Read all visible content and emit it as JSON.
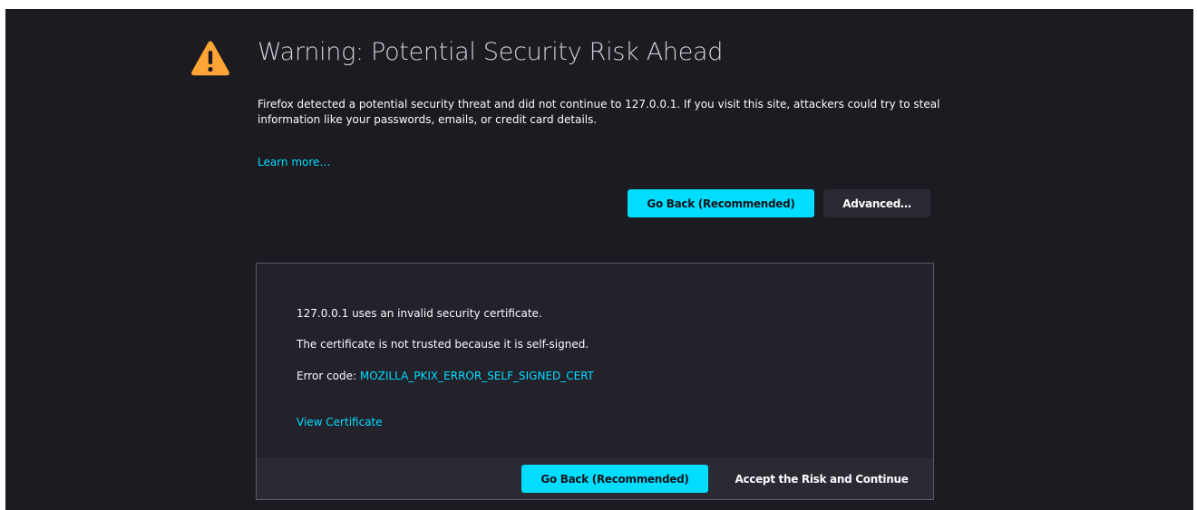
{
  "header": {
    "title": "Warning: Potential Security Risk Ahead",
    "icon": "warning-triangle-icon"
  },
  "description": "Firefox detected a potential security threat and did not continue to 127.0.0.1. If you visit this site, attackers could try to steal information like your passwords, emails, or credit card details.",
  "learn_more": "Learn more…",
  "buttons": {
    "go_back": "Go Back (Recommended)",
    "advanced": "Advanced…"
  },
  "advanced_panel": {
    "line1": "127.0.0.1 uses an invalid security certificate.",
    "line2": "The certificate is not trusted because it is self-signed.",
    "error_label": "Error code: ",
    "error_code": "MOZILLA_PKIX_ERROR_SELF_SIGNED_CERT",
    "view_certificate": "View Certificate",
    "go_back": "Go Back (Recommended)",
    "accept": "Accept the Risk and Continue"
  },
  "colors": {
    "background": "#1c1b22",
    "accent": "#00ddff",
    "warning": "#ffa436",
    "panel": "#23222b",
    "secondary_button": "#2b2a33"
  }
}
